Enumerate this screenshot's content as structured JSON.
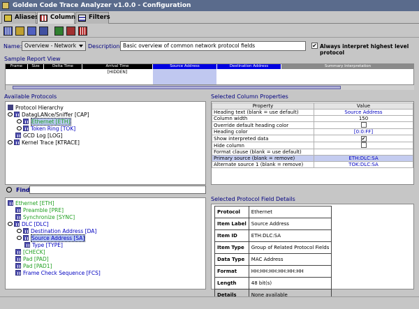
{
  "window": {
    "title": "Golden Code Trace Analyzer v1.0.0 - Configuration"
  },
  "tabs": [
    {
      "label": "Aliases",
      "icon": "aliases-icon"
    },
    {
      "label": "Columns",
      "icon": "columns-icon"
    },
    {
      "label": "Filters",
      "icon": "filters-icon"
    }
  ],
  "form": {
    "name_label": "Name:",
    "name_value": "Overview - Network",
    "description_label": "Description:",
    "description_value": "Basic overview of common network protocol fields",
    "interpret_label": "Always interpret highest level protocol"
  },
  "sample": {
    "title": "Sample Report View",
    "columns": [
      "Frame",
      "Size",
      "Delta Time",
      "Arrival Time",
      "Source Address",
      "Destination Address",
      "Summary Interpretation"
    ],
    "hidden_text": "[HIDDEN]"
  },
  "available": {
    "title": "Available Protocols",
    "tree": [
      {
        "label": "Protocol Hierarchy"
      },
      {
        "label": "DatagLANce/Sniffer [CAP]"
      },
      {
        "label": "Ethernet [ETH]"
      },
      {
        "label": "Token Ring [TOK]"
      },
      {
        "label": "GCD Log [LOG]"
      },
      {
        "label": "Kernel Trace [KTRACE]"
      }
    ],
    "find_label": "Find:",
    "fields": [
      {
        "label": "Ethernet [ETH]"
      },
      {
        "label": "Preamble [PRE]"
      },
      {
        "label": "Synchronize [SYNC]"
      },
      {
        "label": "DLC [DLC]"
      },
      {
        "label": "Destination Address [DA]"
      },
      {
        "label": "Source Address [SA]"
      },
      {
        "label": "Type [TYPE]"
      },
      {
        "label": "[CHECK]"
      },
      {
        "label": "Pad [PAD]"
      },
      {
        "label": "Pad [PAD1]"
      },
      {
        "label": "Frame Check Sequence [FCS]"
      }
    ]
  },
  "column_props": {
    "title": "Selected Column Properties",
    "header_property": "Property",
    "header_value": "Value",
    "rows": [
      {
        "property": "Heading text (blank = use default)",
        "value": "Source Address"
      },
      {
        "property": "Column width",
        "value": "150"
      },
      {
        "property": "Override default heading color",
        "value": ""
      },
      {
        "property": "Heading color",
        "value": "[0:0:FF]"
      },
      {
        "property": "Show interpreted data",
        "value": "✔"
      },
      {
        "property": "Hide column",
        "value": ""
      },
      {
        "property": "Format clause (blank = use default)",
        "value": ""
      },
      {
        "property": "Primary source (blank = remove)",
        "value": "ETH:DLC:SA"
      },
      {
        "property": "Alternate source 1 (blank = remove)",
        "value": "TOK:DLC:SA"
      }
    ]
  },
  "field_details": {
    "title": "Selected Protocol Field Details",
    "rows": [
      {
        "key": "Protocol",
        "value": "Ethernet"
      },
      {
        "key": "Item Label",
        "value": "Source Address"
      },
      {
        "key": "Item ID",
        "value": "ETH:DLC:SA"
      },
      {
        "key": "Item Type",
        "value": "Group of Related Protocol Fields"
      },
      {
        "key": "Data Type",
        "value": "MAC Address"
      },
      {
        "key": "Format",
        "value": "HH:HH:HH:HH:HH:HH"
      },
      {
        "key": "Length",
        "value": "48 bit(s)"
      },
      {
        "key": "Details",
        "value": "None available"
      }
    ]
  }
}
